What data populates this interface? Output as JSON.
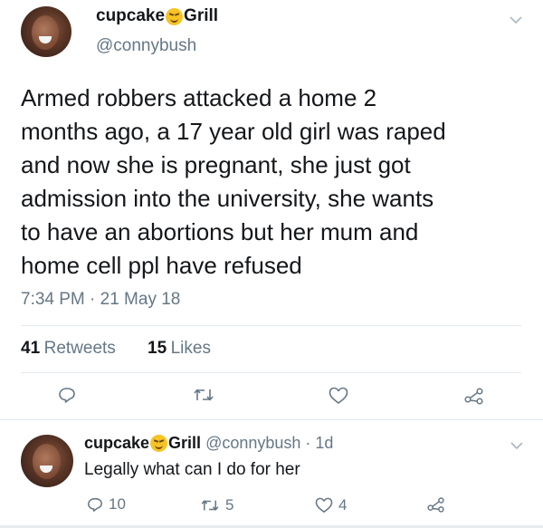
{
  "main_tweet": {
    "display_name_part1": "cupcake",
    "display_name_part2": "Grill",
    "handle": "@connybush",
    "text_lines": [
      "Armed robbers attacked a home 2",
      "months ago, a 17 year old girl was raped",
      "and now she is pregnant, she just got",
      "admission into the university, she wants",
      "to have an abortions but her mum and",
      "home cell ppl have refused"
    ],
    "timestamp": "7:34 PM · 21 May 18",
    "retweets_count": "41",
    "retweets_label": "Retweets",
    "likes_count": "15",
    "likes_label": "Likes"
  },
  "reply": {
    "display_name_part1": "cupcake",
    "display_name_part2": "Grill",
    "handle": "@connybush",
    "age": "· 1d",
    "text": "Legally what can I do for her",
    "reply_count": "10",
    "retweet_count": "5",
    "like_count": "4"
  },
  "colors": {
    "text_primary": "#14171a",
    "text_secondary": "#657786",
    "divider": "#e1e8ed",
    "emoji": "#f7c325"
  },
  "icons": [
    "chevron-down-icon",
    "reply-icon",
    "retweet-icon",
    "like-icon",
    "share-icon",
    "grinning-squint-emoji-icon"
  ]
}
